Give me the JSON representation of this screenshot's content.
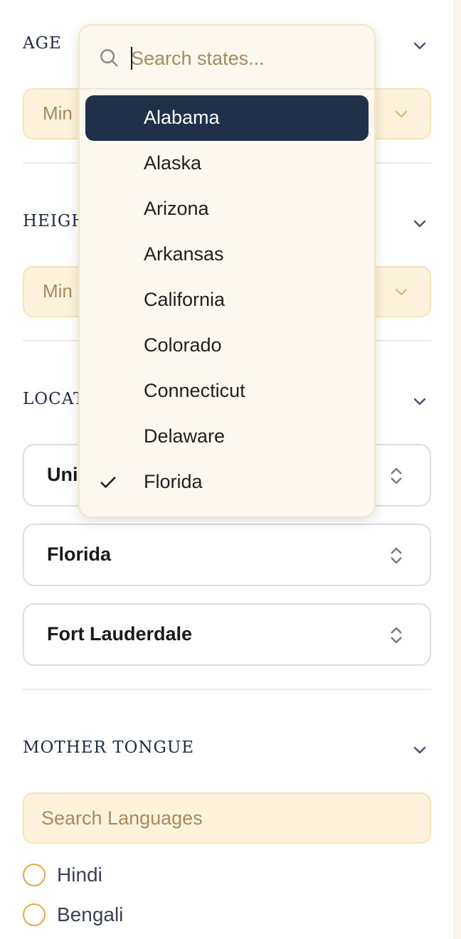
{
  "sections": {
    "age": {
      "title": "AGE",
      "min_label": "Min"
    },
    "height": {
      "title": "HEIGH",
      "min_label": "Min"
    },
    "location": {
      "title": "LOCAT",
      "country_value": "Uni",
      "state_value": "Florida",
      "city_value": "Fort Lauderdale"
    },
    "mother_tongue": {
      "title": "MOTHER TONGUE",
      "search_placeholder": "Search Languages",
      "languages": [
        "Hindi",
        "Bengali"
      ]
    }
  },
  "state_dropdown": {
    "search_placeholder": "Search states...",
    "options": [
      "Alabama",
      "Alaska",
      "Arizona",
      "Arkansas",
      "California",
      "Colorado",
      "Connecticut",
      "Delaware",
      "Florida"
    ],
    "highlighted": "Alabama",
    "selected": "Florida"
  },
  "colors": {
    "accent_dark": "#203049",
    "pill_bg": "#fdf3dc",
    "radio_border": "#e6a744"
  },
  "icons": [
    "search-icon",
    "chevron-down-icon",
    "up-down-chevron-icon",
    "check-icon"
  ]
}
